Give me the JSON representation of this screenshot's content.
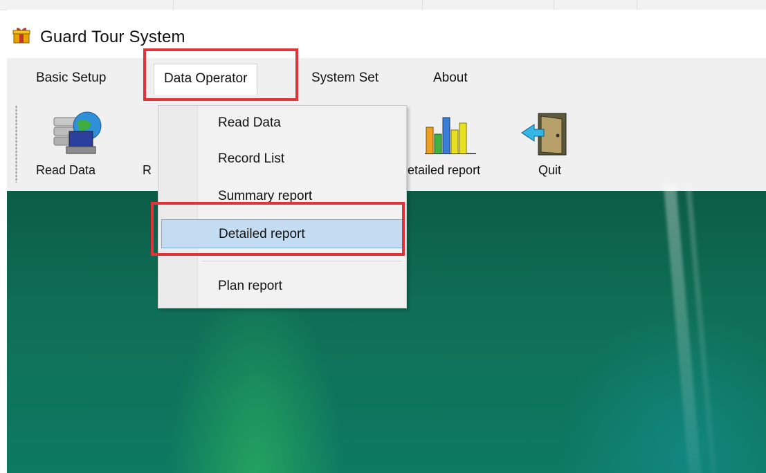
{
  "window": {
    "title": "Guard Tour System"
  },
  "menubar": {
    "items": [
      {
        "label": "Basic Setup"
      },
      {
        "label": "Data Operator"
      },
      {
        "label": "System Set"
      },
      {
        "label": "About"
      }
    ]
  },
  "toolbar": {
    "read_data_label": "Read Data",
    "partial_label": "R",
    "detailed_report_label": "Detailed report",
    "quit_label": "Quit"
  },
  "dropdown": {
    "items": [
      {
        "label": "Read Data"
      },
      {
        "label": "Record List"
      },
      {
        "label": "Summary report"
      },
      {
        "label": "Detailed report"
      },
      {
        "label": "Plan report"
      }
    ],
    "highlighted": "Detailed report"
  },
  "colors": {
    "annotation_red": "#e0333a",
    "menu_highlight": "#c3dcf2",
    "workspace_green": "#0f6e55"
  }
}
